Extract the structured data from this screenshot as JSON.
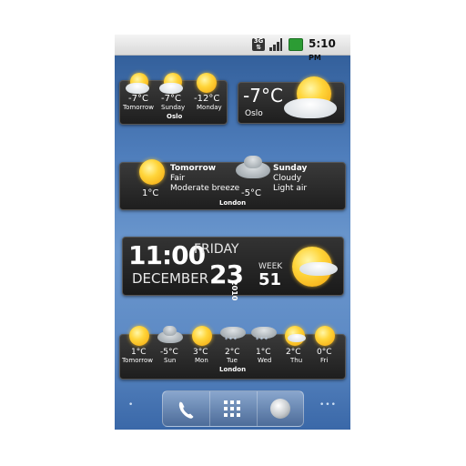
{
  "status_bar": {
    "network": "3G",
    "time": "5:10",
    "ampm": "PM"
  },
  "oslo_forecast": {
    "city": "Oslo",
    "days": [
      {
        "temp": "-7°C",
        "label": "Tomorrow",
        "icon": "partly-cloudy-icon"
      },
      {
        "temp": "-7°C",
        "label": "Sunday",
        "icon": "partly-cloudy-icon"
      },
      {
        "temp": "-12°C",
        "label": "Monday",
        "icon": "sun-icon"
      }
    ]
  },
  "oslo_current": {
    "temp": "-7°C",
    "city": "Oslo",
    "icon": "partly-cloudy-icon"
  },
  "london_two_day": {
    "city": "London",
    "day1": {
      "label": "Tomorrow",
      "condition": "Fair",
      "wind": "Moderate breeze",
      "temp": "1°C"
    },
    "day2": {
      "label": "Sunday",
      "condition": "Cloudy",
      "wind": "Light air",
      "temp": "-5°C"
    }
  },
  "clock": {
    "time": "11:00",
    "weekday": "FRIDAY",
    "month": "DECEMBER",
    "day": "23",
    "year": "2010",
    "week_label": "WEEK",
    "week": "51"
  },
  "london_week": {
    "city": "London",
    "days": [
      {
        "temp": "1°C",
        "label": "Tomorrow",
        "icon": "sun-icon"
      },
      {
        "temp": "-5°C",
        "label": "Sun",
        "icon": "cloud-icon"
      },
      {
        "temp": "3°C",
        "label": "Mon",
        "icon": "sun-icon"
      },
      {
        "temp": "2°C",
        "label": "Tue",
        "icon": "snow-cloud-icon"
      },
      {
        "temp": "1°C",
        "label": "Wed",
        "icon": "snow-cloud-icon"
      },
      {
        "temp": "2°C",
        "label": "Thu",
        "icon": "partly-cloudy-icon"
      },
      {
        "temp": "0°C",
        "label": "Fri",
        "icon": "sun-icon"
      }
    ]
  },
  "dock": {
    "left": "•",
    "right": "•••"
  }
}
